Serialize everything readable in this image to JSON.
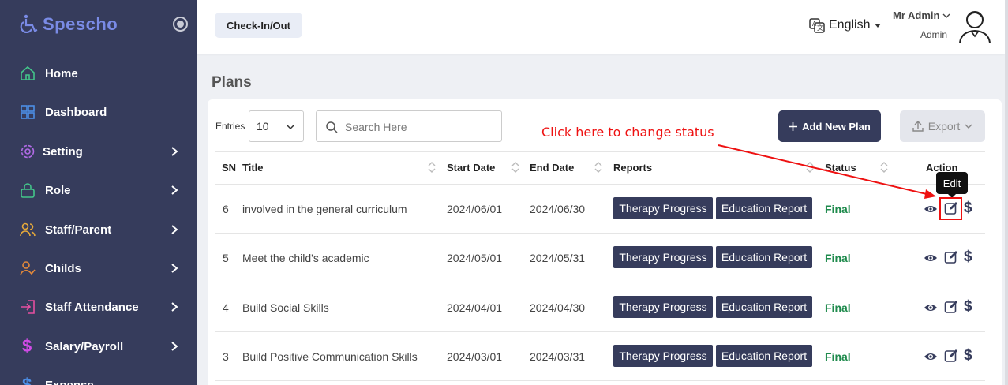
{
  "brand": {
    "name": "Spescho"
  },
  "sidebar": {
    "items": [
      {
        "label": "Home",
        "icon": "home-icon"
      },
      {
        "label": "Dashboard",
        "icon": "grid-icon"
      },
      {
        "label": "Setting",
        "icon": "gear-icon"
      },
      {
        "label": "Role",
        "icon": "lock-icon"
      },
      {
        "label": "Staff/Parent",
        "icon": "users-icon"
      },
      {
        "label": "Childs",
        "icon": "child-icon"
      },
      {
        "label": "Staff Attendance",
        "icon": "login-icon"
      },
      {
        "label": "Salary/Payroll",
        "icon": "dollar-icon"
      },
      {
        "label": "Expense",
        "icon": "dollar-icon"
      }
    ],
    "colors": {
      "bg": "#363c5c",
      "accent": "#7a8be6"
    }
  },
  "topbar": {
    "checkin_label": "Check-In/Out",
    "language": "English",
    "user_name": "Mr Admin",
    "user_role": "Admin"
  },
  "page": {
    "title": "Plans"
  },
  "toolbar": {
    "entries_label": "Entries",
    "entries_value": "10",
    "search_placeholder": "Search Here",
    "add_label": "Add New Plan",
    "export_label": "Export"
  },
  "table": {
    "headers": [
      "SN",
      "Title",
      "Start Date",
      "End Date",
      "Reports",
      "Status",
      "Action"
    ],
    "report_buttons": [
      "Therapy Progress",
      "Education Report"
    ],
    "rows": [
      {
        "sn": "6",
        "title": "involved in the general curriculum",
        "start": "2024/06/01",
        "end": "2024/06/30",
        "status": "Final"
      },
      {
        "sn": "5",
        "title": "Meet the child's academic",
        "start": "2024/05/01",
        "end": "2024/05/31",
        "status": "Final"
      },
      {
        "sn": "4",
        "title": "Build Social Skills",
        "start": "2024/04/01",
        "end": "2024/04/30",
        "status": "Final"
      },
      {
        "sn": "3",
        "title": "Build Positive Communication Skills",
        "start": "2024/03/01",
        "end": "2024/03/31",
        "status": "Final"
      }
    ],
    "action_dollar": "$",
    "status_color": "#1e8a4c"
  },
  "annotation": {
    "tooltip": "Edit",
    "text": "Click here to change status",
    "color": "#e11111"
  }
}
